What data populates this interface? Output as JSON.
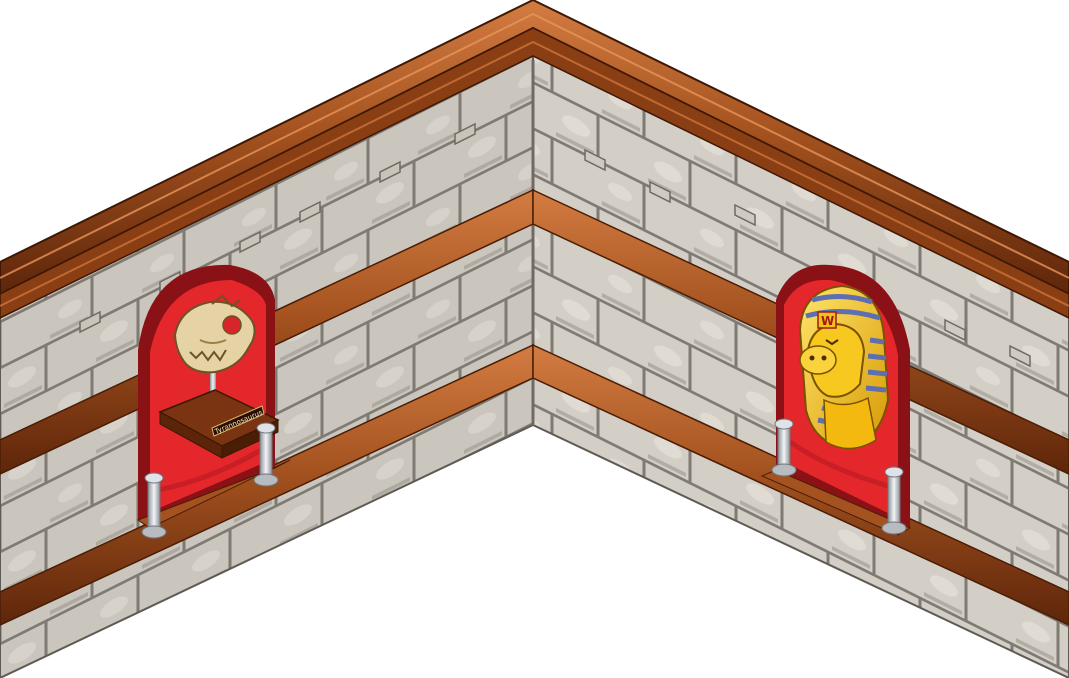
{
  "scene": {
    "type": "isometric-room-corner",
    "background": "#ffffff"
  },
  "colors": {
    "stone_light": "#cfcac1",
    "stone_mid": "#b5afa6",
    "stone_dark": "#8f8a82",
    "mortar": "#7f7a73",
    "wood_light": "#c46f37",
    "wood_mid": "#9b4a1e",
    "wood_dark": "#6a2c0c",
    "alcove_red": "#e3272b",
    "alcove_red_dark": "#a3141a",
    "rope_red": "#c81e25",
    "gold": "#f2c01a",
    "stripe_blue": "#6d7fbf",
    "chrome": "#c9cdd2"
  },
  "left_exhibit": {
    "item": "dinosaur-skull",
    "plaque_text": "Tyrannosaurus"
  },
  "right_exhibit": {
    "item": "pharaoh-bust",
    "emblem_text": "W"
  }
}
